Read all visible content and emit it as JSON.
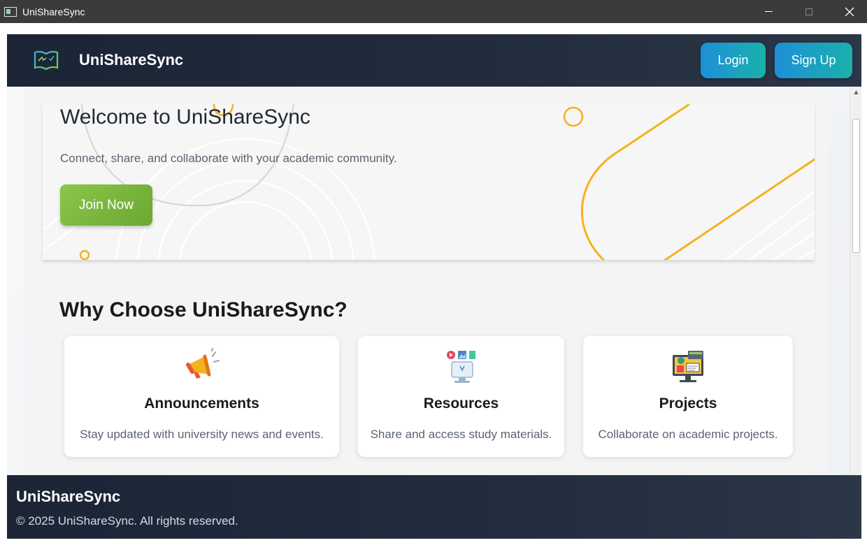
{
  "window": {
    "title": "UniShareSync"
  },
  "navbar": {
    "brand": "UniShareSync",
    "login_label": "Login",
    "signup_label": "Sign Up",
    "logo_icon": "open-book-icon"
  },
  "hero": {
    "title": "Welcome to UniShareSync",
    "subtitle": "Connect, share, and collaborate with your academic community.",
    "cta_label": "Join Now"
  },
  "features": {
    "heading": "Why Choose UniShareSync?",
    "cards": [
      {
        "icon": "megaphone-icon",
        "title": "Announcements",
        "description": "Stay updated with university news and events."
      },
      {
        "icon": "resources-monitor-icon",
        "title": "Resources",
        "description": "Share and access study materials."
      },
      {
        "icon": "projects-computer-icon",
        "title": "Projects",
        "description": "Collaborate on academic projects."
      }
    ]
  },
  "footer": {
    "brand": "UniShareSync",
    "copyright": "© 2025 UniShareSync. All rights reserved."
  },
  "colors": {
    "nav_bg": "#1b2536",
    "primary_gradient_start": "#1e8fd8",
    "primary_gradient_end": "#19b1ab",
    "cta_green": "#7bb83f",
    "accent_orange": "#f5b21b"
  }
}
